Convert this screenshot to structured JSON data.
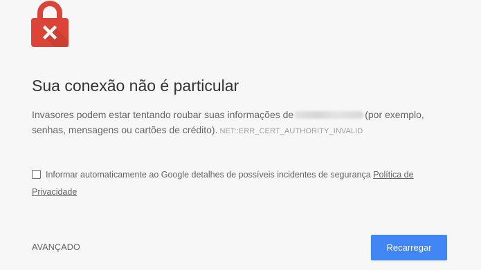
{
  "icon": {
    "name": "lock-error-icon",
    "color": "#db4437",
    "mark_color": "#ffffff"
  },
  "title": "Sua conexão não é particular",
  "description": {
    "text_before": "Invasores podem estar tentando roubar suas informações de",
    "text_after": "(por exemplo, senhas, mensagens ou cartões de crédito).",
    "error_code": "NET::ERR_CERT_AUTHORITY_INVALID"
  },
  "optin": {
    "checked": false,
    "label": "Informar automaticamente ao Google detalhes de possíveis incidentes de segurança",
    "link": "Política de Privacidade"
  },
  "buttons": {
    "advanced": "AVANÇADO",
    "reload": "Recarregar"
  },
  "colors": {
    "background": "#f7f7f7",
    "primary_button": "#4285f4"
  }
}
